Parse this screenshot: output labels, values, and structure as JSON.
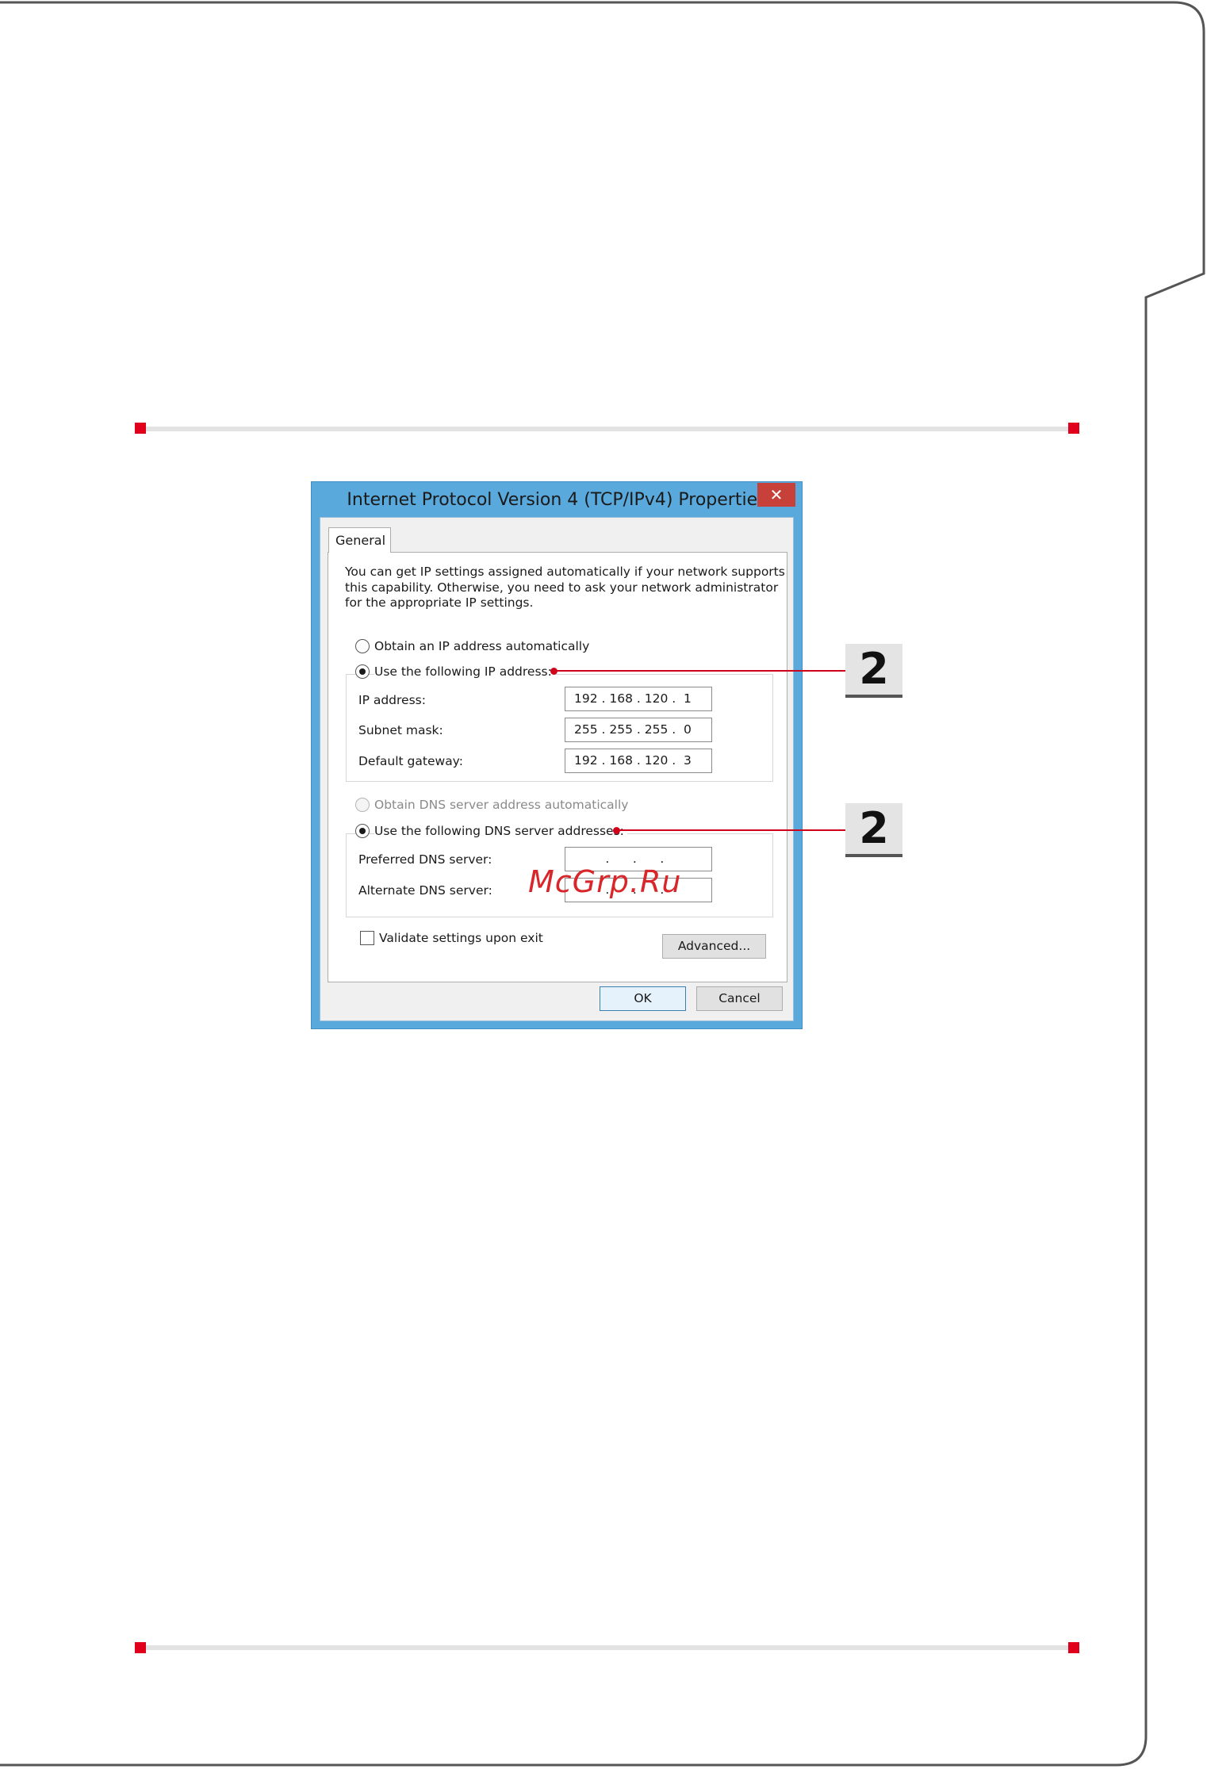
{
  "dialog": {
    "title": "Internet Protocol Version 4 (TCP/IPv4) Properties",
    "close_glyph": "✕",
    "tab_general": "General",
    "intro_lines": [
      "You can get IP settings assigned automatically if your network supports",
      "this capability. Otherwise, you need to ask your network administrator",
      "for the appropriate IP settings."
    ],
    "obtain_ip_auto": "Obtain an IP address automatically",
    "use_following_ip": "Use the following IP address:",
    "ip_address_label": "IP address:",
    "ip_address_value": "192 . 168 . 120 .  1",
    "subnet_mask_label": "Subnet mask:",
    "subnet_mask_value": "255 . 255 . 255 .  0",
    "default_gateway_label": "Default gateway:",
    "default_gateway_value": "192 . 168 . 120 .  3",
    "obtain_dns_auto": "Obtain DNS server address automatically",
    "use_following_dns": "Use the following DNS server addresses:",
    "preferred_dns_label": "Preferred DNS server:",
    "preferred_dns_value": "        .      .      .",
    "alternate_dns_label": "Alternate DNS server:",
    "alternate_dns_value": "        .      .      .",
    "validate_settings": "Validate settings upon exit",
    "advanced_button": "Advanced...",
    "ok_button": "OK",
    "cancel_button": "Cancel"
  },
  "callouts": [
    "2",
    "2"
  ],
  "watermark": "McGrp.Ru",
  "colors": {
    "accent_red": "#d0021b",
    "title_bar_blue": "#5aa9dc",
    "close_button_red": "#c7413a"
  }
}
